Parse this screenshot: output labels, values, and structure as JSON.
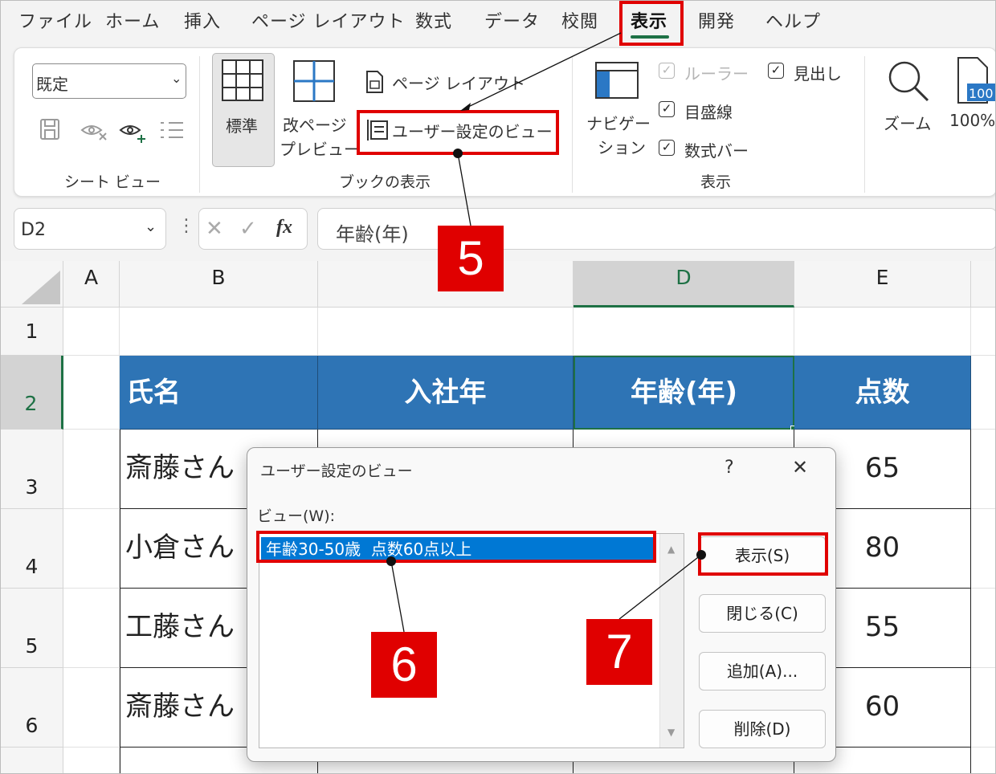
{
  "menu": {
    "items": [
      "ファイル",
      "ホーム",
      "挿入",
      "ページ レイアウト",
      "数式",
      "データ",
      "校閲",
      "表示",
      "開発",
      "ヘルプ"
    ],
    "active": "表示"
  },
  "ribbon": {
    "sheet_view": {
      "select_value": "既定",
      "group_label": "シート ビュー"
    },
    "workbook_views": {
      "normal": "標準",
      "page_break_1": "改ページ",
      "page_break_2": "プレビュー",
      "page_layout": "ページ レイアウト",
      "custom_views": "ユーザー設定のビュー",
      "group_label": "ブックの表示"
    },
    "show": {
      "navigation_1": "ナビゲー",
      "navigation_2": "ション",
      "ruler": "ルーラー",
      "gridlines": "目盛線",
      "formula_bar": "数式バー",
      "headings": "見出し",
      "group_label": "表示"
    },
    "zoom": {
      "zoom_label": "ズーム",
      "zoom100_label": "100%",
      "zoom100_icon_text": "100"
    }
  },
  "formula_bar": {
    "name_box": "D2",
    "fx": "fx",
    "content": "年齢(年)"
  },
  "grid": {
    "columns": [
      "A",
      "B",
      "",
      "D",
      "E"
    ],
    "rows": [
      "1",
      "2",
      "3",
      "4",
      "5",
      "6"
    ],
    "table": {
      "headers": [
        "氏名",
        "入社年",
        "年齢(年)",
        "点数"
      ],
      "names": [
        "斎藤さん",
        "小倉さん",
        "工藤さん",
        "斎藤さん"
      ],
      "scores": [
        "65",
        "80",
        "55",
        "60"
      ]
    }
  },
  "dialog": {
    "title": "ユーザー設定のビュー",
    "help": "?",
    "close": "✕",
    "list_label": "ビュー(W):",
    "selected_view": "年齢30-50歳  点数60点以上",
    "buttons": {
      "show": "表示(S)",
      "close": "閉じる(C)",
      "add": "追加(A)...",
      "delete": "削除(D)"
    }
  },
  "callouts": [
    "5",
    "6",
    "7"
  ],
  "colors": {
    "annotation": "#e00000",
    "table_header": "#2e74b5",
    "excel_green": "#1e7145",
    "selection": "#0078d4"
  }
}
